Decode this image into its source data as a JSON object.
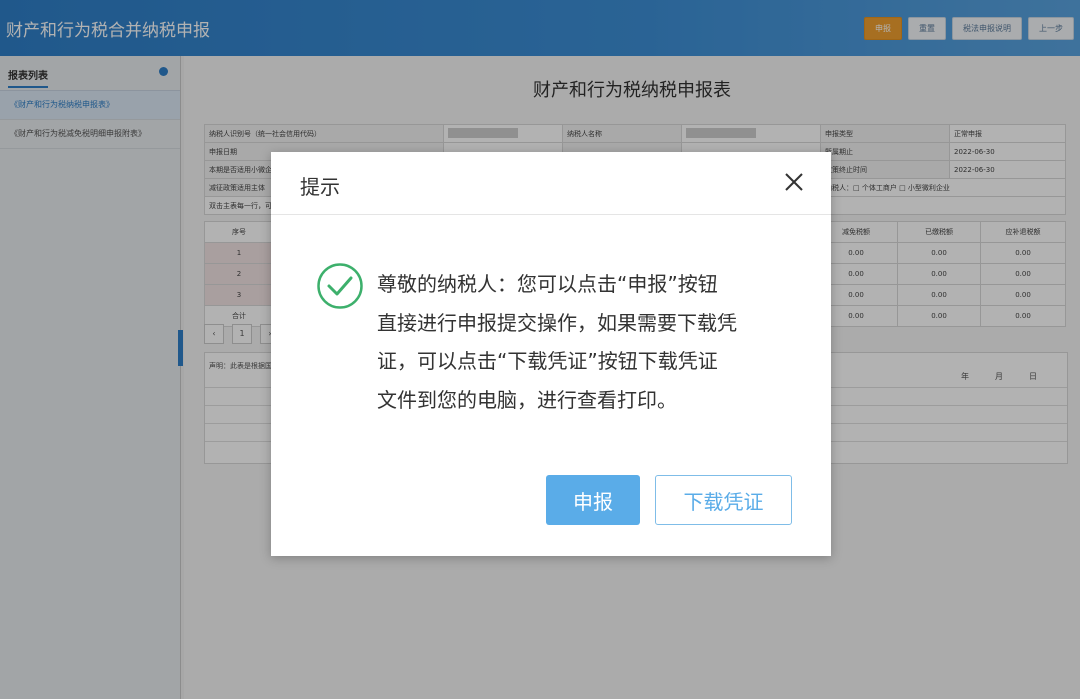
{
  "app": {
    "title": "财产和行为税合并纳税申报",
    "toolbar": [
      "申报",
      "重置",
      "税法申报说明",
      "上一步"
    ]
  },
  "sidebar": {
    "title": "报表列表",
    "items": [
      "《财产和行为税纳税申报表》",
      "《财产和行为税减免税明细申报附表》"
    ]
  },
  "report": {
    "title": "财产和行为税纳税申报表",
    "rows": [
      [
        "纳税人识别号（统一社会信用代码）",
        "",
        "纳税人名称",
        "",
        "申报类型",
        "正常申报"
      ],
      [
        "申报日期",
        "",
        "",
        "",
        "所属期止",
        "2022-06-30"
      ],
      [
        "本期是否适用小微企",
        "",
        "",
        "",
        "政策终止时间",
        "2022-06-30"
      ],
      [
        "减征政策适用主体",
        "",
        "",
        "",
        "纳税人：□ 个体工商户 □ 小型微利企业",
        ""
      ],
      [
        "双击主表每一行，可",
        "",
        "",
        "",
        "",
        ""
      ]
    ],
    "grid_header": [
      "序号",
      "",
      "",
      "",
      "减免税额",
      "已缴税额",
      "应补退税额"
    ],
    "grid_rows": [
      [
        "1",
        "",
        "",
        "",
        "0.00",
        "0.00",
        "0.00"
      ],
      [
        "2",
        "",
        "",
        "",
        "0.00",
        "0.00",
        "0.00"
      ],
      [
        "3",
        "",
        "",
        "",
        "0.00",
        "0.00",
        "0.00"
      ],
      [
        "合计",
        "",
        "",
        "",
        "0.00",
        "0.00",
        "0.00"
      ]
    ],
    "pager": [
      "‹",
      "1",
      "›"
    ],
    "declaration": "声明：此表是根据国",
    "date_labels": [
      "年",
      "月",
      "日"
    ]
  },
  "dialog": {
    "title": "提示",
    "close_icon": "close-icon",
    "message": "尊敬的纳税人：您可以点击“申报”按钮直接进行申报提交操作，如果需要下载凭证，可以点击“下载凭证”按钮下载凭证文件到您的电脑，进行查看打印。",
    "message_lines": [
      "尊敬的纳税人：您可以点击“申报”按钮",
      "直接进行申报提交操作，如果需要下载凭",
      "证，可以点击“下载凭证”按钮下载凭证",
      "文件到您的电脑，进行查看打印。"
    ],
    "submit_label": "申报",
    "download_label": "下载凭证",
    "success_color": "#3db06c",
    "accent": "#5aace8"
  }
}
